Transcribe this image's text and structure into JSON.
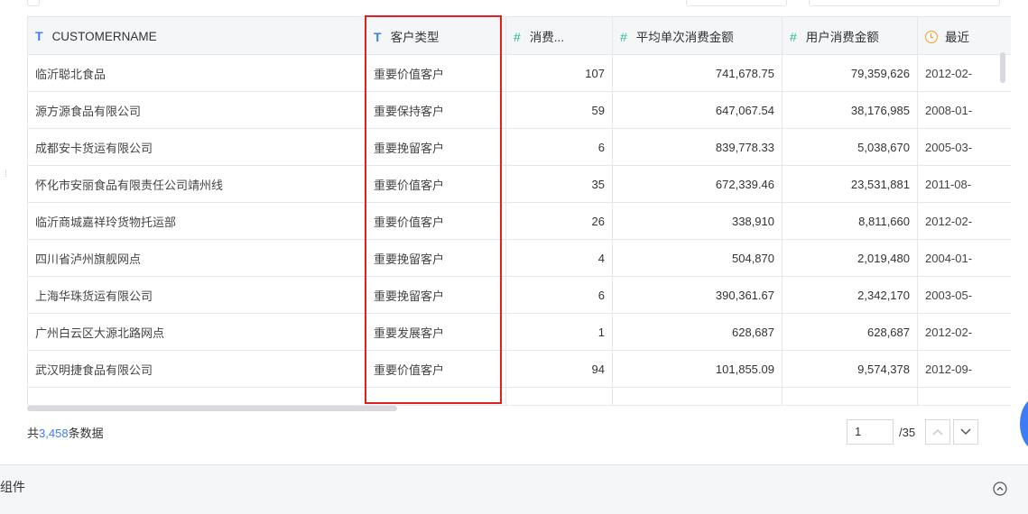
{
  "table": {
    "columns": [
      {
        "label": "CUSTOMERNAME",
        "icon": "text-type-icon"
      },
      {
        "label": "客户类型",
        "icon": "text-type-icon"
      },
      {
        "label": "消费...",
        "icon": "number-type-icon"
      },
      {
        "label": "平均单次消费金额",
        "icon": "number-type-icon"
      },
      {
        "label": "用户消费金额",
        "icon": "number-type-icon"
      },
      {
        "label": "最近",
        "icon": "clock-icon"
      }
    ],
    "rows": [
      {
        "name": "临沂聪北食品",
        "type": "重要价值客户",
        "count": "107",
        "avg": "741,678.75",
        "total": "79,359,626",
        "date": "2012-02-"
      },
      {
        "name": "源方源食品有限公司",
        "type": "重要保持客户",
        "count": "59",
        "avg": "647,067.54",
        "total": "38,176,985",
        "date": "2008-01-"
      },
      {
        "name": "成都安卡货运有限公司",
        "type": "重要挽留客户",
        "count": "6",
        "avg": "839,778.33",
        "total": "5,038,670",
        "date": "2005-03-"
      },
      {
        "name": "怀化市安丽食品有限责任公司靖州线",
        "type": "重要价值客户",
        "count": "35",
        "avg": "672,339.46",
        "total": "23,531,881",
        "date": "2011-08-"
      },
      {
        "name": "临沂商城嘉祥玲货物托运部",
        "type": "重要价值客户",
        "count": "26",
        "avg": "338,910",
        "total": "8,811,660",
        "date": "2012-02-"
      },
      {
        "name": "四川省泸州旗舰网点",
        "type": "重要挽留客户",
        "count": "4",
        "avg": "504,870",
        "total": "2,019,480",
        "date": "2004-01-"
      },
      {
        "name": "上海华珠货运有限公司",
        "type": "重要挽留客户",
        "count": "6",
        "avg": "390,361.67",
        "total": "2,342,170",
        "date": "2003-05-"
      },
      {
        "name": "广州白云区大源北路网点",
        "type": "重要发展客户",
        "count": "1",
        "avg": "628,687",
        "total": "628,687",
        "date": "2012-02-"
      },
      {
        "name": "武汉明捷食品有限公司",
        "type": "重要价值客户",
        "count": "94",
        "avg": "101,855.09",
        "total": "9,574,378",
        "date": "2012-09-"
      }
    ]
  },
  "footer": {
    "prefix": "共",
    "count": "3,458",
    "suffix": "条数据"
  },
  "pager": {
    "current": "1",
    "total": "/35"
  },
  "bottom_bar": {
    "label": "组件"
  },
  "colors": {
    "accent": "#3d7cf5",
    "highlight": "#e02020",
    "number_icon": "#2fb89a",
    "date_icon": "#f0a020"
  }
}
